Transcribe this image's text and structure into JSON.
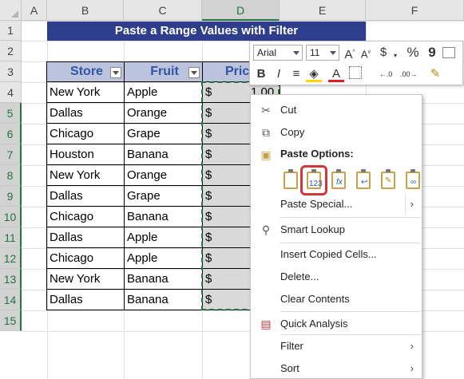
{
  "columns": [
    "A",
    "B",
    "C",
    "D",
    "E",
    "F"
  ],
  "rows": [
    "1",
    "2",
    "3",
    "4",
    "5",
    "6",
    "7",
    "8",
    "9",
    "10",
    "11",
    "12",
    "13",
    "14",
    "15"
  ],
  "title": "Paste a Range Values with Filter",
  "table": {
    "headers": [
      "Store",
      "Fruit",
      "Pric"
    ],
    "rows": [
      {
        "store": "New York",
        "fruit": "Apple",
        "price": "$"
      },
      {
        "store": "Dallas",
        "fruit": "Orange",
        "price": "$"
      },
      {
        "store": "Chicago",
        "fruit": "Grape",
        "price": "$"
      },
      {
        "store": "Houston",
        "fruit": "Banana",
        "price": "$"
      },
      {
        "store": "New York",
        "fruit": "Orange",
        "price": "$"
      },
      {
        "store": "Dallas",
        "fruit": "Grape",
        "price": "$"
      },
      {
        "store": "Chicago",
        "fruit": "Banana",
        "price": "$"
      },
      {
        "store": "Dallas",
        "fruit": "Apple",
        "price": "$"
      },
      {
        "store": "Chicago",
        "fruit": "Apple",
        "price": "$"
      },
      {
        "store": "New York",
        "fruit": "Banana",
        "price": "$"
      },
      {
        "store": "Dallas",
        "fruit": "Banana",
        "price": "$"
      }
    ],
    "e5_value": "1.00"
  },
  "mini_toolbar": {
    "font": "Arial",
    "size": "11",
    "icons": [
      "grow-font-icon",
      "shrink-font-icon",
      "currency-icon",
      "percent-icon",
      "comma-icon",
      "number-format-icon",
      "bold-icon",
      "italic-icon",
      "align-center-icon",
      "fill-color-icon",
      "font-color-icon",
      "borders-icon",
      "increase-decimal-icon",
      "decrease-decimal-icon",
      "format-painter-icon"
    ]
  },
  "context_menu": {
    "cut": "Cut",
    "copy": "Copy",
    "paste_options": "Paste Options:",
    "paste_special": "Paste Special...",
    "smart_lookup": "Smart Lookup",
    "insert_copied": "Insert Copied Cells...",
    "delete": "Delete...",
    "clear": "Clear Contents",
    "quick_analysis": "Quick Analysis",
    "filter": "Filter",
    "sort": "Sort"
  },
  "colors": {
    "title_bg": "#2f3e8c",
    "header_bg": "#bcc3dc",
    "header_text": "#2f55a4",
    "excel_green": "#217346",
    "highlight": "#d0373a"
  }
}
